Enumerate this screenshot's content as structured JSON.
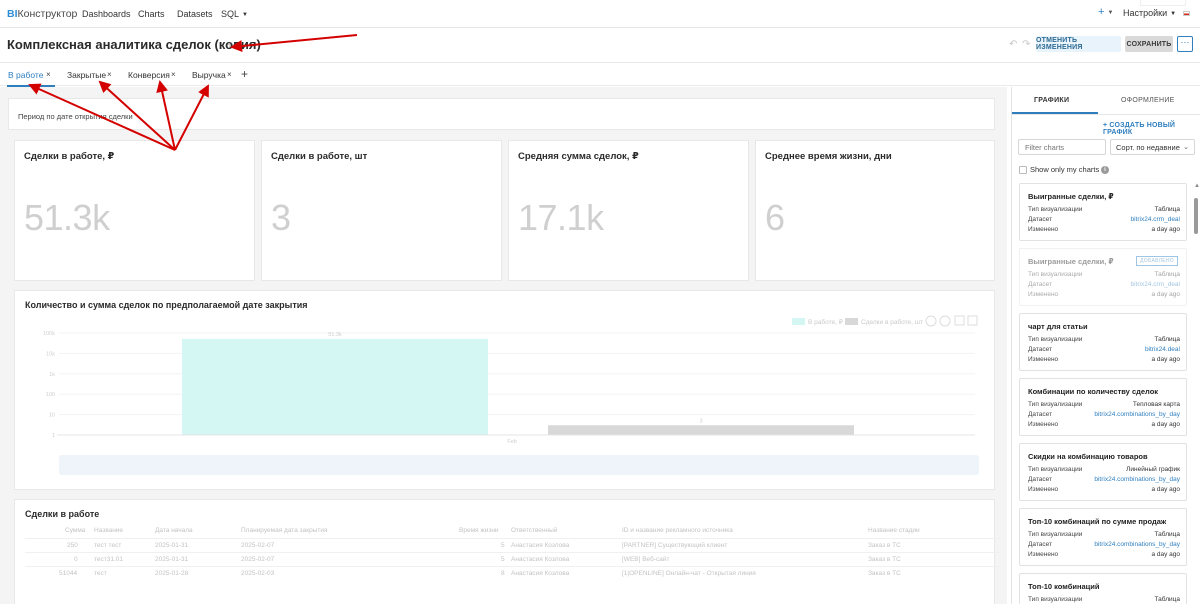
{
  "nav": {
    "logo_bi": "BI",
    "logo_rest": "Конструктор",
    "items": [
      "Dashboards",
      "Charts",
      "Datasets",
      "SQL"
    ],
    "plus": "+",
    "settings": "Настройки"
  },
  "header": {
    "title": "Комплексная аналитика сделок (копия)",
    "star": "☆",
    "undo": "↶",
    "redo": "↷",
    "cancel_label": "ОТМЕНИТЬ ИЗМЕНЕНИЯ",
    "save_label": "СОХРАНИТЬ",
    "more_label": "···"
  },
  "tabs": [
    {
      "label": "В работе",
      "active": true
    },
    {
      "label": "Закрытые",
      "active": false
    },
    {
      "label": "Конверсия",
      "active": false
    },
    {
      "label": "Выручка",
      "active": false
    }
  ],
  "tab_add": "+",
  "tab_close": "×",
  "period_label": "Период по дате открытия сделки",
  "kpis": [
    {
      "title": "Сделки в работе, ₽",
      "value": "51.3k"
    },
    {
      "title": "Сделки в работе, шт",
      "value": "3"
    },
    {
      "title": "Средняя сумма сделок, ₽",
      "value": "17.1k"
    },
    {
      "title": "Среднее время жизни, дни",
      "value": "6"
    }
  ],
  "chart_widget": {
    "title": "Количество и сумма сделок по предполагаемой дате закрытия",
    "legend_1": "В работе, ₽",
    "legend_2": "Сделки в работе, шт",
    "y_ticks": [
      "100k",
      "10k",
      "1k",
      "100",
      "10",
      "1"
    ],
    "bar_label_1": "51.3k",
    "bar_label_2": "3",
    "x_label": "Feb"
  },
  "chart_data": {
    "type": "bar",
    "categories": [
      "Feb"
    ],
    "series": [
      {
        "name": "В работе, ₽",
        "values": [
          51300
        ],
        "color": "#d4f7f3"
      },
      {
        "name": "Сделки в работе, шт",
        "values": [
          3
        ],
        "color": "#d8d8d8"
      }
    ],
    "y_scale": "log",
    "ylim": [
      1,
      100000
    ],
    "title": "Количество и сумма сделок по предполагаемой дате закрытия"
  },
  "table_widget": {
    "title": "Сделки в работе",
    "headers": [
      "Сумма",
      "Название",
      "Дата начала",
      "Планируемая дата закрытия",
      "Время жизни",
      "Ответственный",
      "ID и название рекламного источника",
      "Название стадии"
    ],
    "rows": [
      [
        "250",
        "тест тест",
        "2025-01-31",
        "2025-02-07",
        "5",
        "Анастасия Козлова",
        "[PARTNER] Существующий клиент",
        "Заказ в ТС"
      ],
      [
        "0",
        "тест31.01",
        "2025-01-31",
        "2025-02-07",
        "5",
        "Анастасия Козлова",
        "[WEB] Веб-сайт",
        "Заказ в ТС"
      ],
      [
        "51044",
        "тест",
        "2025-01-28",
        "2025-02-03",
        "8",
        "Анастасия Козлова",
        "[1|OPENLINE] Онлайн-чат - Открытая линия",
        "Заказ в ТС"
      ]
    ]
  },
  "panel": {
    "tab_charts": "ГРАФИКИ",
    "tab_design": "ОФОРМЛЕНИЕ",
    "create_chart": "+ СОЗДАТЬ НОВЫЙ ГРАФИК",
    "filter_placeholder": "Filter charts",
    "sort_label": "Сорт. по недавние",
    "show_only_mine": "Show only my charts",
    "row_type": "Тип визуализации",
    "row_dataset": "Датасет",
    "row_changed": "Изменено",
    "cards": [
      {
        "title": "Выигранные сделки, ₽",
        "type": "Таблица",
        "dataset": "bitrix24.crm_deal",
        "changed": "a day ago",
        "badge": "",
        "faded": false
      },
      {
        "title": "Выигранные сделки, ₽",
        "type": "Таблица",
        "dataset": "bitrix24.crm_deal",
        "changed": "a day ago",
        "badge": "ДОБАВЛЕНО",
        "faded": true
      },
      {
        "title": "чарт для статьи",
        "type": "Таблица",
        "dataset": "bitrix24.deal",
        "changed": "a day ago",
        "badge": "",
        "faded": false
      },
      {
        "title": "Комбинации по количеству сделок",
        "type": "Тепловая карта",
        "dataset": "bitrix24.combinations_by_day",
        "changed": "a day ago",
        "badge": "",
        "faded": false
      },
      {
        "title": "Скидки на комбинацию товаров",
        "type": "Линейный график",
        "dataset": "bitrix24.combinations_by_day",
        "changed": "a day ago",
        "badge": "",
        "faded": false
      },
      {
        "title": "Топ-10 комбинаций по сумме продаж",
        "type": "Таблица",
        "dataset": "bitrix24.combinations_by_day",
        "changed": "a day ago",
        "badge": "",
        "faded": false
      },
      {
        "title": "Топ-10 комбинаций",
        "type": "Таблица",
        "dataset": "",
        "changed": "",
        "badge": "",
        "faded": false
      }
    ]
  },
  "colors": {
    "accent": "#2f7fbf",
    "annotation_arrow": "#d40000",
    "bar_primary": "#d4f7f3",
    "bar_secondary": "#d8d8d8"
  }
}
